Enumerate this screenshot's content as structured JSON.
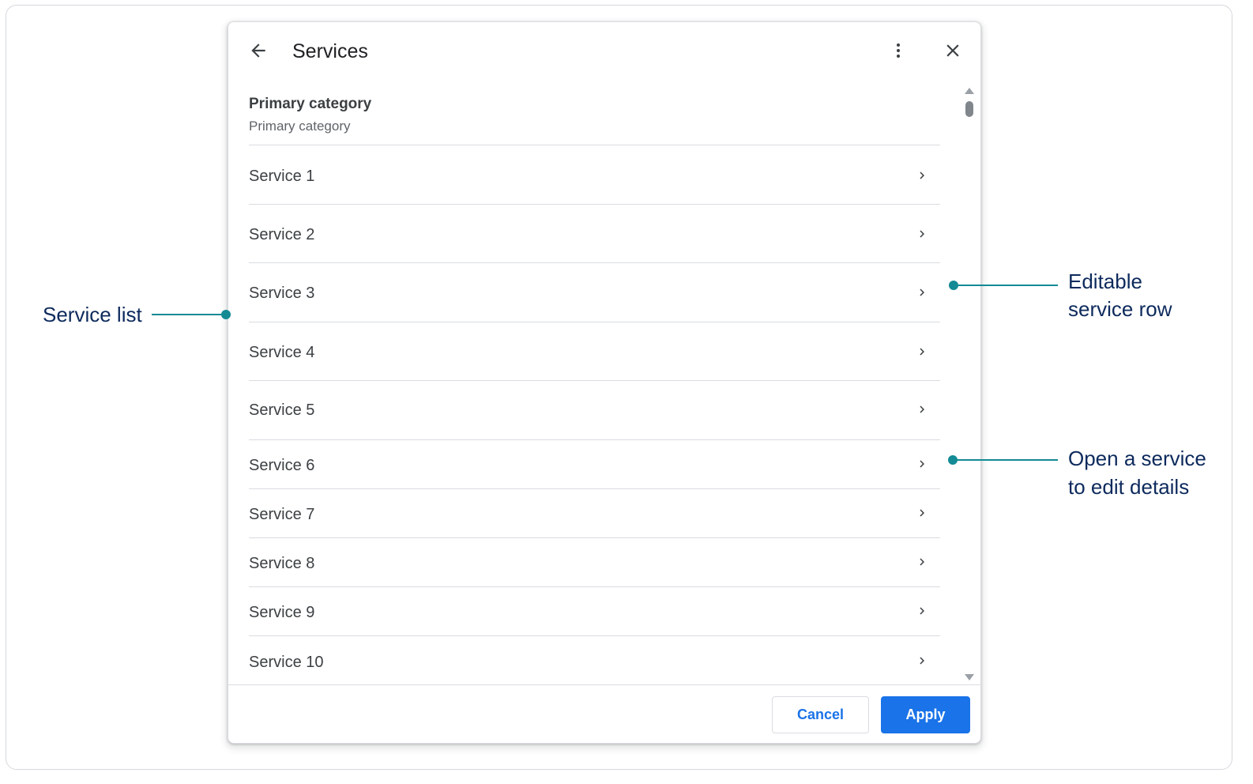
{
  "dialog": {
    "title": "Services",
    "section_title": "Primary category",
    "section_subtitle": "Primary category",
    "services": [
      "Service 1",
      "Service 2",
      "Service 3",
      "Service 4",
      "Service 5",
      "Service 6",
      "Service 7",
      "Service 8",
      "Service 9",
      "Service 10"
    ],
    "cancel_label": "Cancel",
    "apply_label": "Apply"
  },
  "callouts": {
    "service_list": "Service list",
    "editable_line1": "Editable",
    "editable_line2": "service row",
    "open_line1": "Open a service",
    "open_line2": "to edit details"
  },
  "icons": {
    "back": "arrow-back-icon",
    "menu": "more-vert-icon",
    "close": "close-icon",
    "row": "chevron-right-icon"
  },
  "colors": {
    "primary": "#1a73e8",
    "callout_accent": "#138a94",
    "callout_text": "#0d2a5c"
  }
}
